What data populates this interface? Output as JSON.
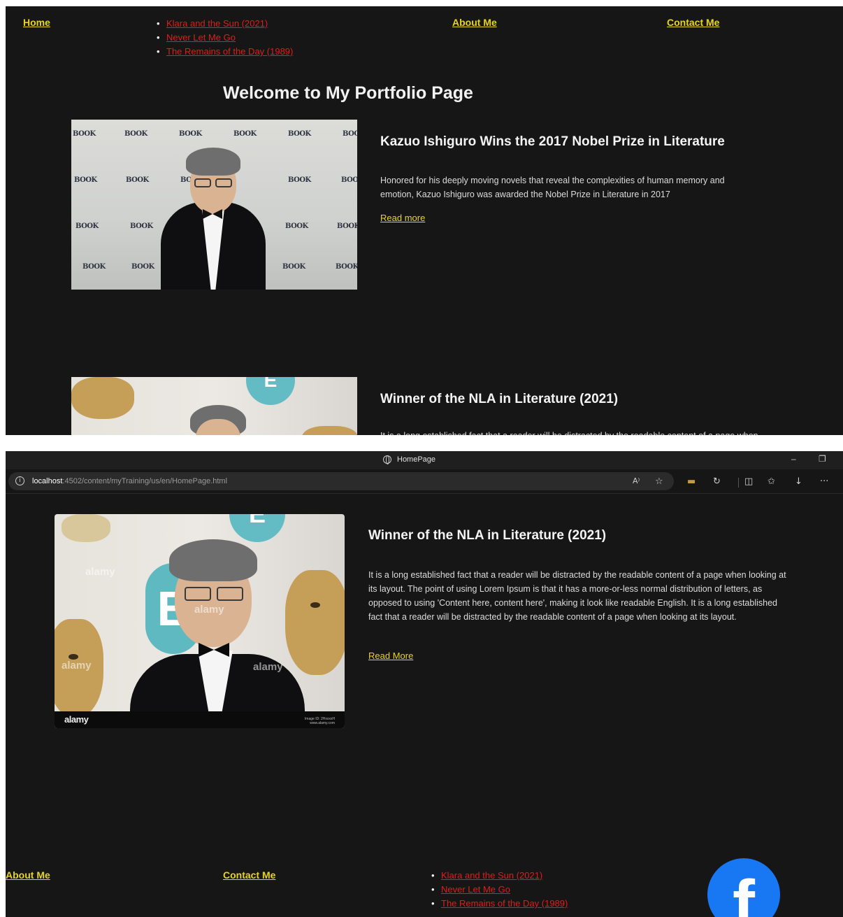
{
  "nav": {
    "home": "Home",
    "books": [
      "Klara and the Sun (2021)",
      "Never Let Me Go",
      "The Remains of the Day (1989)"
    ],
    "about": "About Me",
    "contact": "Contact Me"
  },
  "page_title": "Welcome to My Portfolio Page",
  "card1": {
    "title": "Kazuo Ishiguro Wins the 2017 Nobel Prize in Literature",
    "text": "Honored for his deeply moving novels that reveal the complexities of human memory and emotion, Kazuo Ishiguro was awarded the Nobel Prize in Literature in 2017",
    "link": "Read more",
    "wall_logo": "BOOK"
  },
  "card2": {
    "title": "Winner of the NLA in Literature (2021)",
    "text": "It is a long established fact that a reader will be distracted by the readable content of a page when looking at its layout. The point of using Lorem Ipsum is that it has a more-or-less normal distribution of letters, as opposed to using 'Content here, content here', making it look like readable English. It is a long established fact that a reader will be distracted by the readable content of a page when looking at its layout.",
    "link": "Read More",
    "watermark": "alamy",
    "image_id_line1": "Image ID: 2HxxxxH",
    "image_id_line2": "www.alamy.com"
  },
  "browser": {
    "tab_title": "HomePage",
    "url_host": "localhost",
    "url_path": ":4502/content/myTraining/us/en/HomePage.html",
    "icons": [
      "info-icon",
      "read-aloud-icon",
      "favorite-star-icon",
      "extension-icon",
      "refresh-icon",
      "split-screen-icon",
      "favorites-icon",
      "download-icon",
      "more-icon"
    ]
  },
  "footer": {
    "about": "About Me",
    "contact": "Contact Me",
    "books": [
      "Klara and the Sun (2021)",
      "Never Let Me Go",
      "The Remains of the Day (1989)"
    ],
    "social_icon": "facebook-icon"
  },
  "colors": {
    "background": "#161616",
    "nav_link": "#e6d51e",
    "book_link": "#e41b1b",
    "facebook": "#1877f2"
  }
}
